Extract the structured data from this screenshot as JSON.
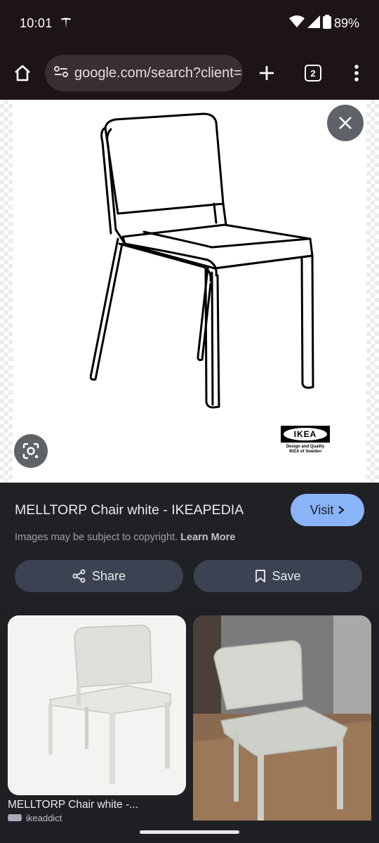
{
  "status": {
    "time": "10:01",
    "battery": "89%"
  },
  "browser": {
    "url": "google.com/search?client=",
    "tab_count": "2"
  },
  "viewer": {
    "ikea_logo_text": "IKEA",
    "ikea_logo_sub": "Design and Quality IKEA of Sweden"
  },
  "result": {
    "title": "MELLTORP Chair white - IKEAPEDIA",
    "visit_label": "Visit",
    "copyright_text": "Images may be subject to copyright.",
    "learn_more_label": "Learn More",
    "share_label": "Share",
    "save_label": "Save"
  },
  "related": {
    "card1_title": "MELLTORP Chair white -...",
    "card1_source": "ikeaddict"
  },
  "colors": {
    "accent": "#8ab4f8",
    "chip_bg": "#3c4251",
    "bar_bg": "#1c1415"
  }
}
